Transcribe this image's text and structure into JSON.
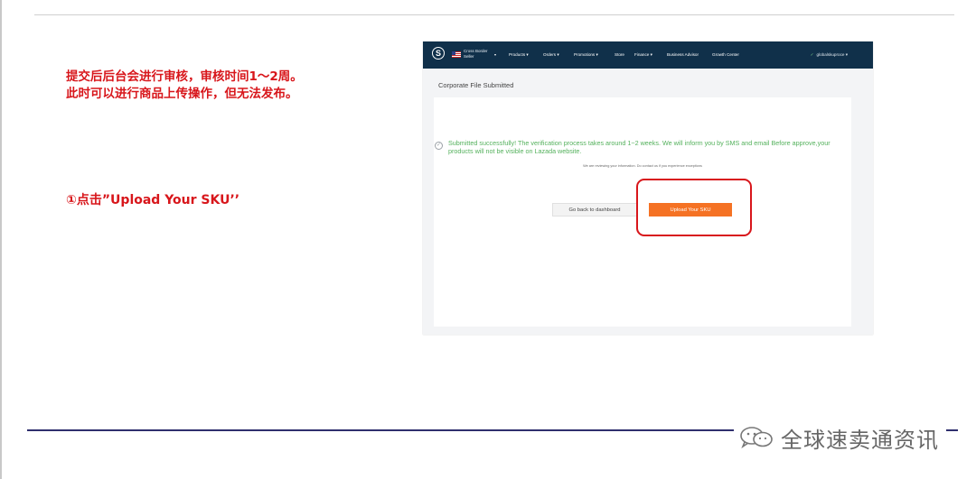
{
  "notes": {
    "line1": "提交后后台会进行审核，审核时间1～2周。",
    "line2": "此时可以进行商品上传操作，但无法发布。",
    "step": "①点击”Upload Your SKU’’"
  },
  "screenshot": {
    "nav": {
      "logo": "S",
      "seller_line1": "Cross Border",
      "seller_line2": "Seller",
      "items": [
        "Products ▾",
        "Orders ▾",
        "Promotions ▾",
        "Store",
        "Finance ▾",
        "Business Advisor",
        "Growth Center"
      ],
      "user": "globalskuproce ▾"
    },
    "page_title": "Corporate File Submitted",
    "success_message": "Submitted successfully! The verification process takes around 1~2 weeks. We will inform you by SMS and email Before approve,your products will not be visible on Lazada website.",
    "review_note": "We are reviewing your information. Do contact us if you experience exceptions",
    "buttons": {
      "dashboard": "Go back to dashboard",
      "upload": "Upload Your SKU"
    }
  },
  "watermark": {
    "icon": "wechat-icon",
    "text": "全球速卖通资讯"
  },
  "colors": {
    "note_red": "#d8161b",
    "nav_bg": "#10304a",
    "accent_orange": "#f57224",
    "success_green": "#54b15c"
  }
}
